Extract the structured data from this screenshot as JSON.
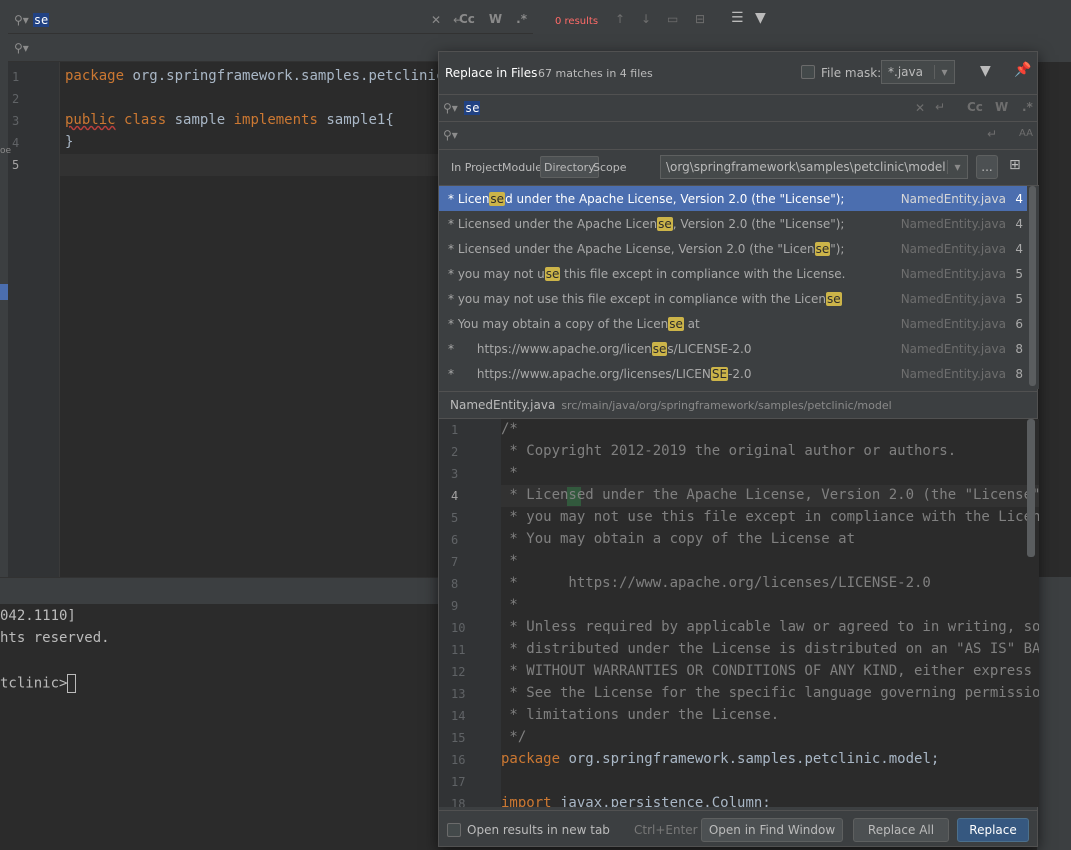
{
  "editor": {
    "search_query": "se",
    "results_label": "0 results",
    "find_case_label": "Cc",
    "find_word_label": "W",
    "find_regex_label": ".*",
    "line_numbers": [
      "1",
      "2",
      "3",
      "4",
      "5"
    ],
    "line1_kw": "package",
    "line1_rest": " org.springframework.samples.petclinic.m",
    "line3_kw1": "public",
    "line3_kw2": "class",
    "line3_name": " sample ",
    "line3_kw3": "implements",
    "line3_iface": " sample1",
    "line3_brace": "{",
    "line4": "}",
    "gutter_marker": "oe"
  },
  "terminal": {
    "lines": [
      "042.1110]",
      "hts reserved.",
      "",
      "tclinic>"
    ]
  },
  "popup": {
    "title": "Replace in Files",
    "subtitle": "67 matches in 4 files",
    "file_mask_label": "File mask:",
    "file_mask_value": "*.java",
    "search_value": "se",
    "case_label": "Cc",
    "word_label": "W",
    "regex_label": ".*",
    "preserve_case_label": "AA",
    "scope_tabs": [
      "In Project",
      "Module",
      "Directory",
      "Scope"
    ],
    "active_scope": "Directory",
    "directory_path": "\\org\\springframework\\samples\\petclinic\\model",
    "browse_label": "...",
    "results": [
      {
        "pre": "* Licen",
        "match": "se",
        "post": "d under the Apache License, Version 2.0 (the \"License\");",
        "file": "NamedEntity.java",
        "line": "4"
      },
      {
        "pre": "* Licensed under the Apache Licen",
        "match": "se",
        "post": ", Version 2.0 (the \"License\");",
        "file": "NamedEntity.java",
        "line": "4"
      },
      {
        "pre": "* Licensed under the Apache License, Version 2.0 (the \"Licen",
        "match": "se",
        "post": "\");",
        "file": "NamedEntity.java",
        "line": "4"
      },
      {
        "pre": "* you may not u",
        "match": "se",
        "post": " this file except in compliance with the License.",
        "file": "NamedEntity.java",
        "line": "5"
      },
      {
        "pre": "* you may not use this file except in compliance with the Licen",
        "match": "se",
        "post": "",
        "file": "NamedEntity.java",
        "line": "5"
      },
      {
        "pre": "* You may obtain a copy of the Licen",
        "match": "se",
        "post": " at",
        "file": "NamedEntity.java",
        "line": "6"
      },
      {
        "pre": "*      https://www.apache.org/licen",
        "match": "se",
        "post": "s/LICENSE-2.0",
        "file": "NamedEntity.java",
        "line": "8"
      },
      {
        "pre": "*      https://www.apache.org/licenses/LICEN",
        "match": "SE",
        "post": "-2.0",
        "file": "NamedEntity.java",
        "line": "8"
      }
    ],
    "preview_file": "NamedEntity.java",
    "preview_path": "src/main/java/org/springframework/samples/petclinic/model",
    "preview_lines": [
      {
        "n": "1",
        "t": "/*"
      },
      {
        "n": "2",
        "t": " * Copyright 2012-2019 the original author or authors."
      },
      {
        "n": "3",
        "t": " *"
      },
      {
        "n": "4",
        "t": " * Licensed under the Apache License, Version 2.0 (the \"License\");"
      },
      {
        "n": "5",
        "t": " * you may not use this file except in compliance with the License."
      },
      {
        "n": "6",
        "t": " * You may obtain a copy of the License at"
      },
      {
        "n": "7",
        "t": " *"
      },
      {
        "n": "8",
        "t": " *      https://www.apache.org/licenses/LICENSE-2.0"
      },
      {
        "n": "9",
        "t": " *"
      },
      {
        "n": "10",
        "t": " * Unless required by applicable law or agreed to in writing, softw"
      },
      {
        "n": "11",
        "t": " * distributed under the License is distributed on an \"AS IS\" BASIS"
      },
      {
        "n": "12",
        "t": " * WITHOUT WARRANTIES OR CONDITIONS OF ANY KIND, either express or"
      },
      {
        "n": "13",
        "t": " * See the License for the specific language governing permissions"
      },
      {
        "n": "14",
        "t": " * limitations under the License."
      },
      {
        "n": "15",
        "t": " */"
      },
      {
        "n": "16",
        "t": "package org.springframework.samples.petclinic.model;"
      },
      {
        "n": "17",
        "t": ""
      },
      {
        "n": "18",
        "t": "import javax.persistence.Column;"
      }
    ],
    "open_in_new_tab_label": "Open results in new tab",
    "shortcut_label": "Ctrl+Enter",
    "open_find_window_label": "Open in Find Window",
    "replace_all_label": "Replace All",
    "replace_label": "Replace"
  },
  "colors": {
    "accent": "#4b6eaf",
    "match_highlight": "#ccb449",
    "keyword": "#cc7832",
    "error": "#ff6b68"
  }
}
